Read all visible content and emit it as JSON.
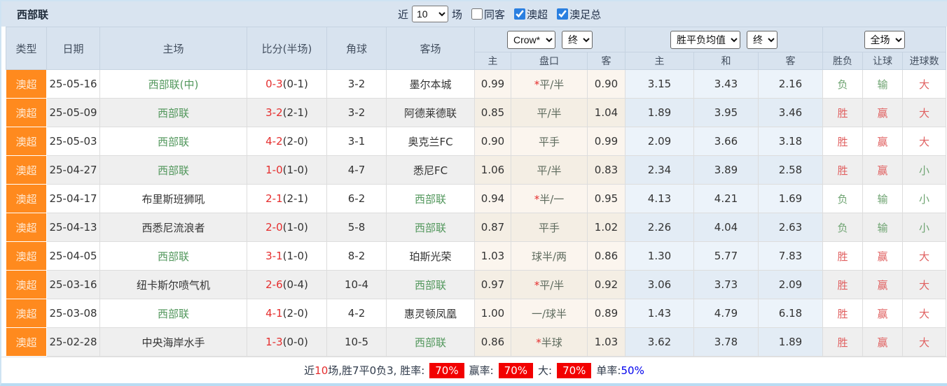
{
  "title": "西部联",
  "topbar": {
    "recent_label": "近",
    "matches_count": "10",
    "matches_label": "场",
    "checkboxes": [
      {
        "label": "同客",
        "checked": false
      },
      {
        "label": "澳超",
        "checked": true
      },
      {
        "label": "澳足总",
        "checked": true
      }
    ]
  },
  "header": {
    "left_columns": [
      "类型",
      "日期",
      "主场",
      "比分(半场)",
      "角球",
      "客场"
    ],
    "odds_company_select": "Crow*",
    "odds_stage_select": "终",
    "avg_select": "胜平负均值",
    "avg_stage_select": "终",
    "scope_select": "全场",
    "sub_columns": [
      "主",
      "盘口",
      "客",
      "主",
      "和",
      "客",
      "胜负",
      "让球",
      "进球数"
    ]
  },
  "rows": [
    {
      "type": "澳超",
      "date": "25-05-16",
      "home": "西部联(中)",
      "home_green": true,
      "score": "0-3",
      "half": "(0-1)",
      "corner": "3-2",
      "away": "墨尔本城",
      "away_green": false,
      "odds_home": "0.99",
      "star": "*",
      "handicap": "平/半",
      "odds_away": "0.90",
      "avg_home": "3.15",
      "avg_draw": "3.43",
      "avg_away": "2.16",
      "wl": "负",
      "let": "输",
      "goals": "大"
    },
    {
      "type": "澳超",
      "date": "25-05-09",
      "home": "西部联",
      "home_green": true,
      "score": "3-2",
      "half": "(2-1)",
      "corner": "3-2",
      "away": "阿德莱德联",
      "away_green": false,
      "odds_home": "0.85",
      "star": "",
      "handicap": "平/半",
      "odds_away": "1.04",
      "avg_home": "1.89",
      "avg_draw": "3.95",
      "avg_away": "3.46",
      "wl": "胜",
      "let": "赢",
      "goals": "大"
    },
    {
      "type": "澳超",
      "date": "25-05-03",
      "home": "西部联",
      "home_green": true,
      "score": "4-2",
      "half": "(2-0)",
      "corner": "3-1",
      "away": "奥克兰FC",
      "away_green": false,
      "odds_home": "0.90",
      "star": "",
      "handicap": "平手",
      "odds_away": "0.99",
      "avg_home": "2.09",
      "avg_draw": "3.66",
      "avg_away": "3.18",
      "wl": "胜",
      "let": "赢",
      "goals": "大"
    },
    {
      "type": "澳超",
      "date": "25-04-27",
      "home": "西部联",
      "home_green": true,
      "score": "1-0",
      "half": "(1-0)",
      "corner": "4-7",
      "away": "悉尼FC",
      "away_green": false,
      "odds_home": "1.06",
      "star": "",
      "handicap": "平/半",
      "odds_away": "0.83",
      "avg_home": "2.34",
      "avg_draw": "3.89",
      "avg_away": "2.58",
      "wl": "胜",
      "let": "赢",
      "goals": "小"
    },
    {
      "type": "澳超",
      "date": "25-04-17",
      "home": "布里斯班狮吼",
      "home_green": false,
      "score": "2-1",
      "half": "(2-1)",
      "corner": "6-2",
      "away": "西部联",
      "away_green": true,
      "odds_home": "0.94",
      "star": "*",
      "handicap": "半/一",
      "odds_away": "0.95",
      "avg_home": "4.13",
      "avg_draw": "4.21",
      "avg_away": "1.69",
      "wl": "负",
      "let": "输",
      "goals": "小"
    },
    {
      "type": "澳超",
      "date": "25-04-13",
      "home": "西悉尼流浪者",
      "home_green": false,
      "score": "2-0",
      "half": "(1-0)",
      "corner": "5-8",
      "away": "西部联",
      "away_green": true,
      "odds_home": "0.87",
      "star": "",
      "handicap": "平手",
      "odds_away": "1.02",
      "avg_home": "2.26",
      "avg_draw": "4.04",
      "avg_away": "2.63",
      "wl": "负",
      "let": "输",
      "goals": "小"
    },
    {
      "type": "澳超",
      "date": "25-04-05",
      "home": "西部联",
      "home_green": true,
      "score": "3-1",
      "half": "(1-0)",
      "corner": "8-2",
      "away": "珀斯光荣",
      "away_green": false,
      "odds_home": "1.03",
      "star": "",
      "handicap": "球半/两",
      "odds_away": "0.86",
      "avg_home": "1.30",
      "avg_draw": "5.77",
      "avg_away": "7.83",
      "wl": "胜",
      "let": "赢",
      "goals": "大"
    },
    {
      "type": "澳超",
      "date": "25-03-16",
      "home": "纽卡斯尔喷气机",
      "home_green": false,
      "score": "2-6",
      "half": "(0-4)",
      "corner": "10-4",
      "away": "西部联",
      "away_green": true,
      "odds_home": "0.97",
      "star": "*",
      "handicap": "平/半",
      "odds_away": "0.92",
      "avg_home": "3.06",
      "avg_draw": "3.73",
      "avg_away": "2.09",
      "wl": "胜",
      "let": "赢",
      "goals": "大"
    },
    {
      "type": "澳超",
      "date": "25-03-08",
      "home": "西部联",
      "home_green": true,
      "score": "4-1",
      "half": "(2-0)",
      "corner": "4-2",
      "away": "惠灵顿凤凰",
      "away_green": false,
      "odds_home": "1.00",
      "star": "",
      "handicap": "一/球半",
      "odds_away": "0.89",
      "avg_home": "1.43",
      "avg_draw": "4.79",
      "avg_away": "6.18",
      "wl": "胜",
      "let": "赢",
      "goals": "大"
    },
    {
      "type": "澳超",
      "date": "25-02-28",
      "home": "中央海岸水手",
      "home_green": false,
      "score": "1-3",
      "half": "(0-0)",
      "corner": "10-5",
      "away": "西部联",
      "away_green": true,
      "odds_home": "0.86",
      "star": "*",
      "handicap": "半球",
      "odds_away": "1.03",
      "avg_home": "3.62",
      "avg_draw": "3.78",
      "avg_away": "1.89",
      "wl": "胜",
      "let": "赢",
      "goals": "大"
    }
  ],
  "footer": {
    "recent_label": "近",
    "recent_count": "10",
    "summary": "场,胜7平0负3, 胜率:",
    "win_rate": "70%",
    "cover_label": "赢率:",
    "cover_rate": "70%",
    "over_label": "大:",
    "over_rate": "70%",
    "single_label": "单率:",
    "single_rate": "50%"
  }
}
